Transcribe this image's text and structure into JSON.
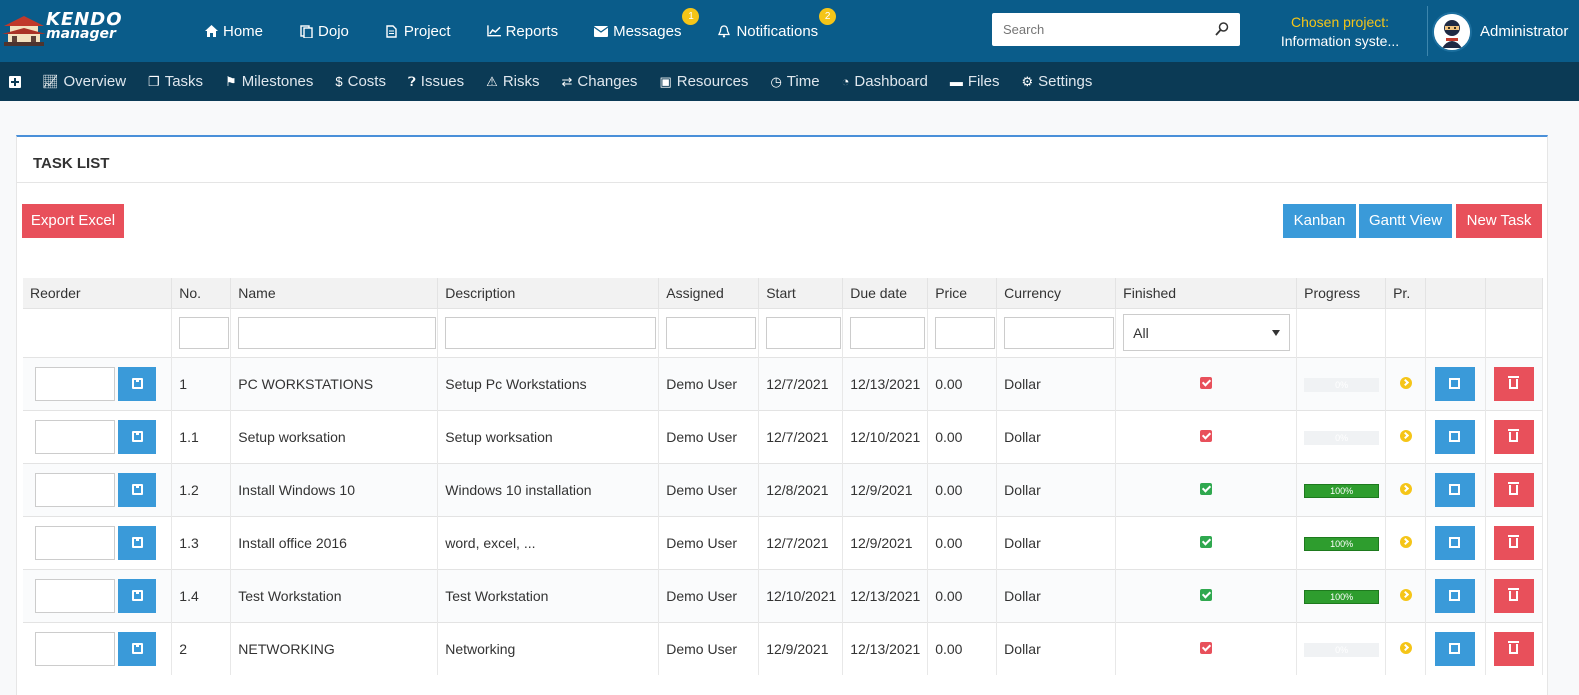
{
  "brand": {
    "line1": "KENDO",
    "line2": "manager"
  },
  "topnav": [
    {
      "label": "Home",
      "icon": "home-icon"
    },
    {
      "label": "Dojo",
      "icon": "dojo-icon"
    },
    {
      "label": "Project",
      "icon": "document-icon"
    },
    {
      "label": "Reports",
      "icon": "chart-icon"
    },
    {
      "label": "Messages",
      "icon": "envelope-icon",
      "badge": "1"
    },
    {
      "label": "Notifications",
      "icon": "bell-icon",
      "badge": "2"
    }
  ],
  "search": {
    "placeholder": "Search"
  },
  "chosen_project": {
    "label": "Chosen project:",
    "value": "Information syste..."
  },
  "user": {
    "name": "Administrator"
  },
  "subnav": [
    {
      "label": "Overview",
      "icon": "line-chart-icon"
    },
    {
      "label": "Tasks",
      "icon": "copy-icon"
    },
    {
      "label": "Milestones",
      "icon": "flag-icon"
    },
    {
      "label": "Costs",
      "icon": "dollar-icon"
    },
    {
      "label": "Issues",
      "icon": "question-circle-icon"
    },
    {
      "label": "Risks",
      "icon": "warning-icon"
    },
    {
      "label": "Changes",
      "icon": "exchange-icon"
    },
    {
      "label": "Resources",
      "icon": "briefcase-icon"
    },
    {
      "label": "Time",
      "icon": "clock-icon"
    },
    {
      "label": "Dashboard",
      "icon": "dashboard-icon"
    },
    {
      "label": "Files",
      "icon": "folder-icon"
    },
    {
      "label": "Settings",
      "icon": "cogs-icon"
    }
  ],
  "panel": {
    "title": "TASK LIST",
    "export_label": "Export Excel",
    "kanban_label": "Kanban",
    "gantt_label": "Gantt View",
    "new_task_label": "New Task"
  },
  "columns": [
    "Reorder",
    "No.",
    "Name",
    "Description",
    "Assigned",
    "Start",
    "Due date",
    "Price",
    "Currency",
    "Finished",
    "Progress",
    "Pr.",
    "",
    ""
  ],
  "finished_filter": "All",
  "rows": [
    {
      "no": "1",
      "name": "PC WORKSTATIONS",
      "description": "Setup Pc Workstations",
      "assigned": "Demo User",
      "start": "12/7/2021",
      "due": "12/13/2021",
      "price": "0.00",
      "currency": "Dollar",
      "finished": false,
      "progress": 0,
      "progress_label": "0%"
    },
    {
      "no": "1.1",
      "name": "Setup worksation",
      "description": "Setup worksation",
      "assigned": "Demo User",
      "start": "12/7/2021",
      "due": "12/10/2021",
      "price": "0.00",
      "currency": "Dollar",
      "finished": false,
      "progress": 0,
      "progress_label": "0%"
    },
    {
      "no": "1.2",
      "name": "Install Windows 10",
      "description": "Windows 10 installation",
      "assigned": "Demo User",
      "start": "12/8/2021",
      "due": "12/9/2021",
      "price": "0.00",
      "currency": "Dollar",
      "finished": true,
      "progress": 100,
      "progress_label": "100%"
    },
    {
      "no": "1.3",
      "name": "Install office 2016",
      "description": "word, excel, ...",
      "assigned": "Demo User",
      "start": "12/7/2021",
      "due": "12/9/2021",
      "price": "0.00",
      "currency": "Dollar",
      "finished": true,
      "progress": 100,
      "progress_label": "100%"
    },
    {
      "no": "1.4",
      "name": "Test Workstation",
      "description": "Test Workstation",
      "assigned": "Demo User",
      "start": "12/10/2021",
      "due": "12/13/2021",
      "price": "0.00",
      "currency": "Dollar",
      "finished": true,
      "progress": 100,
      "progress_label": "100%"
    },
    {
      "no": "2",
      "name": "NETWORKING",
      "description": "Networking",
      "assigned": "Demo User",
      "start": "12/9/2021",
      "due": "12/13/2021",
      "price": "0.00",
      "currency": "Dollar",
      "finished": false,
      "progress": 0,
      "progress_label": "0%"
    }
  ],
  "colors": {
    "topbar": "#0a5c8a",
    "subbar": "#0b3a55",
    "accent_blue": "#3a9ad9",
    "accent_red": "#e8505b",
    "badge": "#f5c518",
    "progress": "#2e9d2e"
  }
}
